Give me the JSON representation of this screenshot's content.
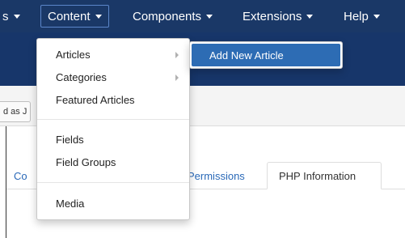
{
  "navbar": {
    "items": [
      {
        "label": "s"
      },
      {
        "label": "Content"
      },
      {
        "label": "Components"
      },
      {
        "label": "Extensions"
      },
      {
        "label": "Help"
      }
    ]
  },
  "toolbar": {
    "partial_button_label": "d as J"
  },
  "dropdown": {
    "items": [
      {
        "label": "Articles",
        "has_submenu": true
      },
      {
        "label": "Categories",
        "has_submenu": true
      },
      {
        "label": "Featured Articles",
        "has_submenu": false
      },
      {
        "label": "Fields",
        "has_submenu": false
      },
      {
        "label": "Field Groups",
        "has_submenu": false
      },
      {
        "label": "Media",
        "has_submenu": false
      }
    ]
  },
  "submenu": {
    "items": [
      {
        "label": "Add New Article",
        "highlighted": true
      }
    ]
  },
  "tabs": [
    {
      "label": "Co",
      "active": false
    },
    {
      "label": "Permissions",
      "active": false
    },
    {
      "label": "PHP Information",
      "active": true
    }
  ],
  "colors": {
    "navbar_bg": "#1a3867",
    "subheader_bg": "#17366a",
    "submenu_highlight": "#2d6cb4",
    "link": "#2a69b8"
  }
}
